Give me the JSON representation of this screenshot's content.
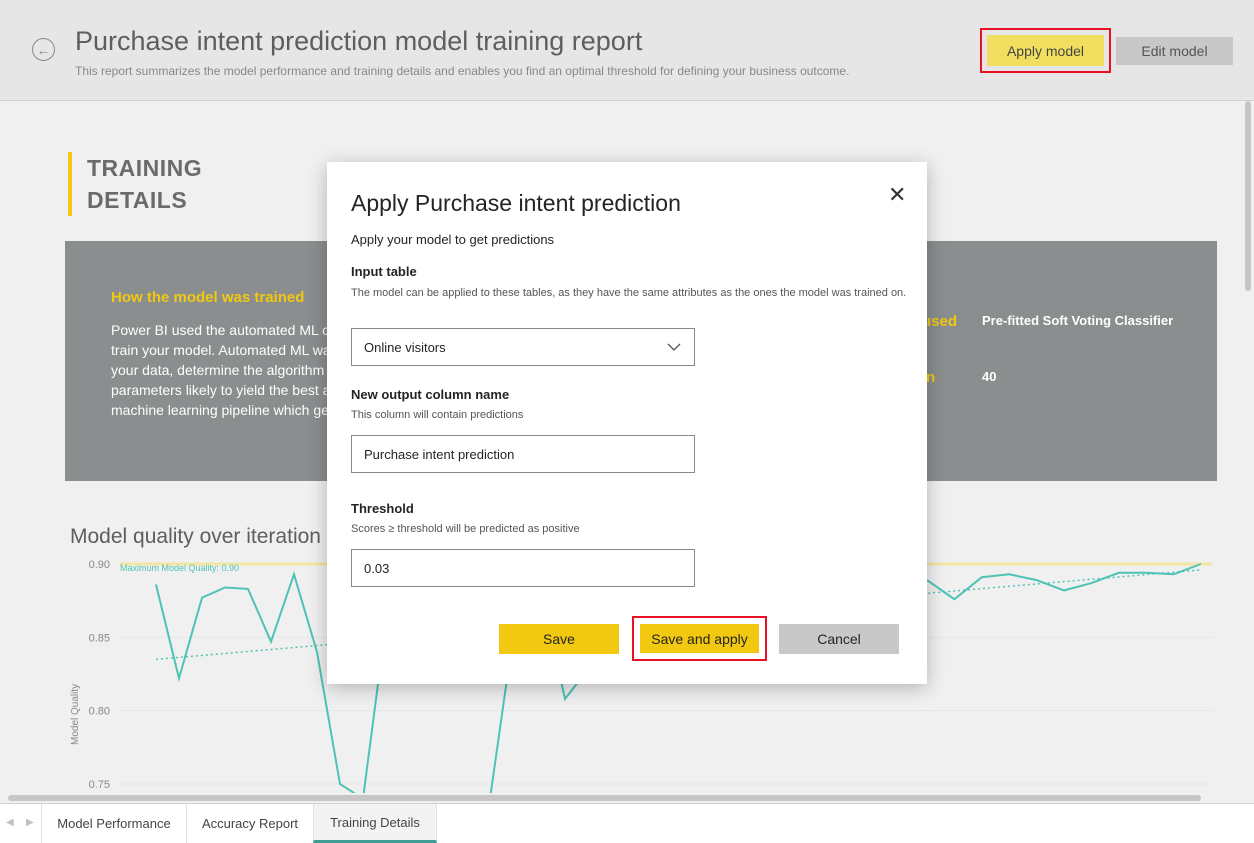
{
  "header": {
    "title": "Purchase intent prediction model training report",
    "subtitle": "This report summarizes the model performance and training details and enables you find an optimal threshold for defining your business outcome.",
    "apply_label": "Apply model",
    "edit_label": "Edit model"
  },
  "section": {
    "heading_line1": "TRAINING",
    "heading_line2": "DETAILS"
  },
  "info_panel": {
    "heading": "How the model was trained",
    "lines": [
      "Power BI used the automated ML ca",
      "train your model. Automated ML wa",
      "your data, determine the algorithm",
      "parameters likely to yield the best a",
      "machine learning pipeline which ge"
    ],
    "right_label_1": "used",
    "right_value_1": "Pre-fitted Soft Voting Classifier",
    "right_label_2": "n",
    "right_value_2": "40"
  },
  "chart": {
    "title": "Model quality over iteration",
    "ylabel": "Model Quality",
    "max_label": "Maximum Model Quality: 0.90"
  },
  "chart_data": {
    "type": "line",
    "title": "Model quality over iteration",
    "xlabel": "",
    "ylabel": "Model Quality",
    "ylim": [
      0.74,
      0.91
    ],
    "yticks": [
      "0.90",
      "0.85",
      "0.80",
      "0.75"
    ],
    "grid": true,
    "reference_line": {
      "label": "Maximum Model Quality: 0.90",
      "value": 0.9
    },
    "series": [
      {
        "values_left": [
          0.886,
          0.822,
          0.877,
          0.884,
          0.883,
          0.847,
          0.893,
          0.84,
          0.75,
          0.74,
          0.86
        ],
        "values_right": [
          0.74,
          0.86,
          0.885,
          0.808,
          0.83
        ],
        "values_far_right": [
          0.889,
          0.876,
          0.891,
          0.893,
          0.889,
          0.882,
          0.887,
          0.894,
          0.894,
          0.893,
          0.9
        ]
      }
    ],
    "trend": {
      "start": 0.835,
      "end": 0.896
    }
  },
  "tabs": [
    {
      "label": "Model Performance",
      "active": false
    },
    {
      "label": "Accuracy Report",
      "active": false
    },
    {
      "label": "Training Details",
      "active": true
    }
  ],
  "modal": {
    "title": "Apply Purchase intent prediction",
    "subtitle": "Apply your model to get predictions",
    "input_table_label": "Input table",
    "input_table_help": "The model can be applied to these tables, as they have the same attributes as the ones the model was trained on.",
    "input_table_value": "Online visitors",
    "output_column_label": "New output column name",
    "output_column_help": "This column will contain predictions",
    "output_column_value": "Purchase intent prediction",
    "threshold_label": "Threshold",
    "threshold_help": "Scores ≥ threshold will be predicted as positive",
    "threshold_value": "0.03",
    "save_label": "Save",
    "save_apply_label": "Save and apply",
    "cancel_label": "Cancel",
    "close_glyph": "✕"
  },
  "colors": {
    "accent": "#f2c811",
    "line": "#4ec3b4",
    "highlight_border": "#e81123",
    "panel": "#8a8e8f"
  }
}
